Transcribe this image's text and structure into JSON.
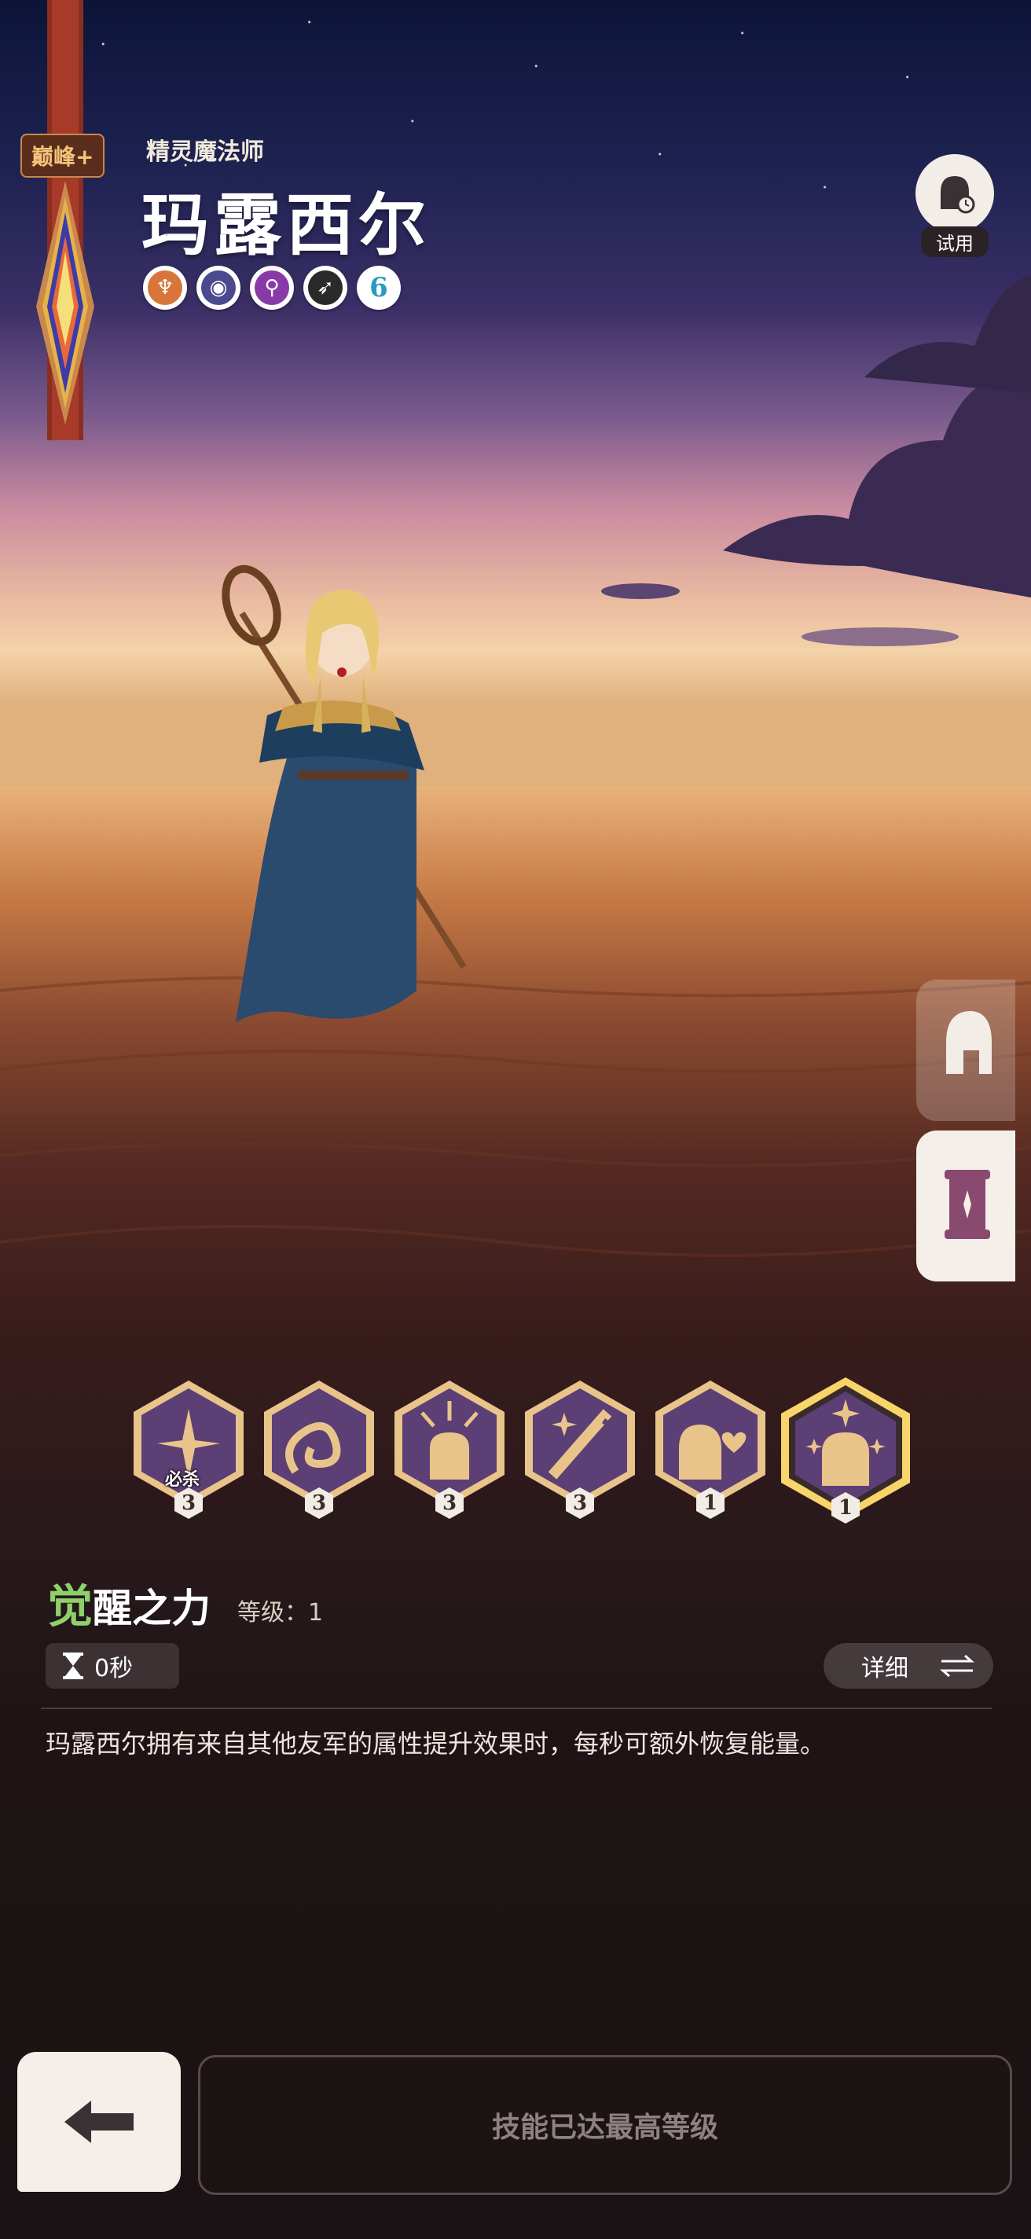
{
  "hero": {
    "rank_label": "巅峰+",
    "class_title": "精灵魔法师",
    "name": "玛露西尔",
    "badge_number": "6"
  },
  "trial": {
    "label": "试用"
  },
  "skills": [
    {
      "level": "3",
      "ult_label": "必杀",
      "icon": "burst-icon"
    },
    {
      "level": "3",
      "ult_label": "",
      "icon": "swirl-icon"
    },
    {
      "level": "3",
      "ult_label": "",
      "icon": "warrior-radiance-icon"
    },
    {
      "level": "3",
      "ult_label": "",
      "icon": "sword-sparkle-icon"
    },
    {
      "level": "1",
      "ult_label": "",
      "icon": "knight-heart-icon"
    },
    {
      "level": "1",
      "ult_label": "",
      "icon": "knight-star-icon",
      "selected": true
    }
  ],
  "selected_skill": {
    "name_first": "觉",
    "name_rest": "醒之力",
    "level_text": "等级：1",
    "cooldown": "0秒",
    "detail_label": "详细",
    "description": "玛露西尔拥有来自其他友军的属性提升效果时，每秒可额外恢复能量。"
  },
  "footer": {
    "max_level_label": "技能已达最高等级"
  },
  "colors": {
    "skill_bg": "#5c3f74",
    "skill_gold": "#e9c48a",
    "highlight": "#8fd06a"
  }
}
